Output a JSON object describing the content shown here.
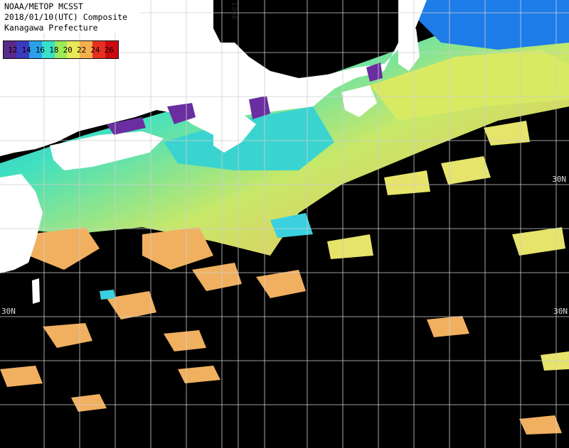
{
  "title": {
    "line1": "NOAA/METOP MCSST",
    "line2": "2018/01/10(UTC) Composite",
    "line3": "Kanagawa Prefecture"
  },
  "legend": {
    "ticks": [
      "12",
      "14",
      "16",
      "18",
      "20",
      "22",
      "24",
      "26"
    ],
    "colors": [
      "#5a2a8a",
      "#3b3bbf",
      "#2aa0e8",
      "#38e0c8",
      "#9aea5a",
      "#e8e858",
      "#f5b050",
      "#e83020",
      "#cc0a10"
    ]
  },
  "grid": {
    "lon_label": "136E",
    "lat_label_upper_right": "30N",
    "lat_label_left": "30N",
    "lat_label_lower_right": "30N"
  },
  "colors": {
    "land": "#ffffff",
    "cloud": "#000000",
    "grid": "#cfcfcf"
  }
}
